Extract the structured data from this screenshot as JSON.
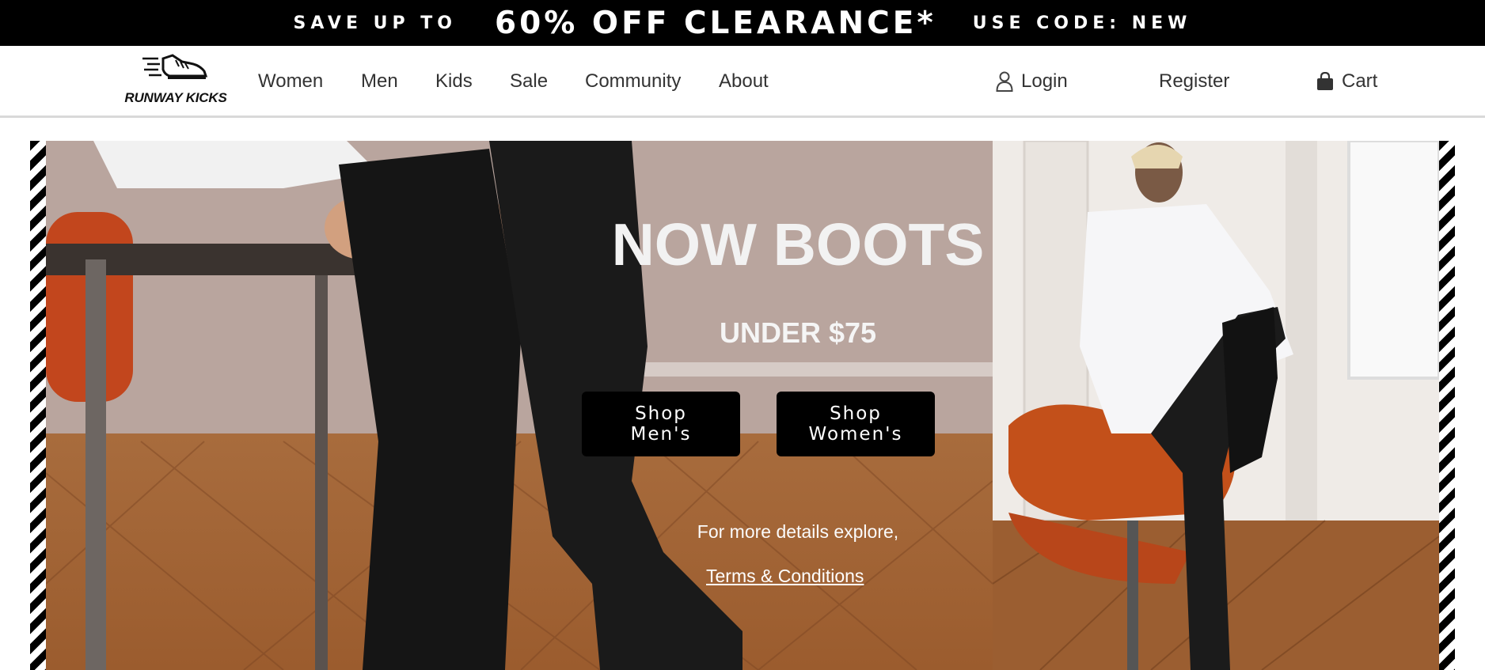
{
  "promo": {
    "lead": "SAVE UP TO",
    "headline": "60% OFF CLEARANCE*",
    "code": "USE CODE: NEW"
  },
  "brand": {
    "name": "RUNWAY KICKS",
    "logo_icon": "sneaker-icon"
  },
  "nav": {
    "items": [
      "Women",
      "Men",
      "Kids",
      "Sale",
      "Community",
      "About"
    ]
  },
  "account": {
    "login_label": "Login",
    "login_icon": "user-icon",
    "register_label": "Register",
    "cart_label": "Cart",
    "cart_icon": "shopping-bag-icon"
  },
  "hero": {
    "title": "NOW BOOTS",
    "subtitle": "UNDER $75",
    "shop_men_label": "Shop\nMen's",
    "shop_women_label": "Shop\nWomen's",
    "details_text": "For more details explore,",
    "terms_link": "Terms & Conditions"
  },
  "colors": {
    "promo_bg": "#000000",
    "button_bg": "#000000",
    "text_white": "#ffffff"
  }
}
